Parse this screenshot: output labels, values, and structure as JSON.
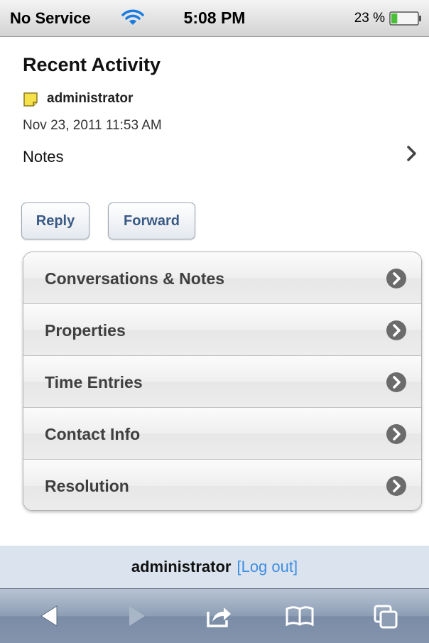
{
  "status_bar": {
    "carrier": "No Service",
    "time": "5:08 PM",
    "battery": "23 %"
  },
  "header": {
    "title": "Recent Activity"
  },
  "activity": {
    "user": "administrator",
    "date": "Nov 23, 2011 11:53 AM",
    "type": "Notes"
  },
  "actions": {
    "reply_label": "Reply",
    "forward_label": "Forward"
  },
  "menu": {
    "items": [
      {
        "label": "Conversations & Notes"
      },
      {
        "label": "Properties"
      },
      {
        "label": "Time Entries"
      },
      {
        "label": "Contact Info"
      },
      {
        "label": "Resolution"
      }
    ]
  },
  "footer": {
    "user": "administrator",
    "logout_label": "[Log out]"
  },
  "colors": {
    "accent_link": "#3d8de0",
    "button_text": "#3a5a86",
    "footer_bg": "#dbe4ee",
    "toolbar_bg": "#8c9db4"
  },
  "icons": {
    "wifi": "wifi-icon",
    "battery": "battery-icon",
    "note": "note-icon",
    "chevron": "chevron-right-icon",
    "menu_arrow": "circle-arrow-right-icon",
    "back": "back-arrow-icon",
    "forward": "forward-arrow-icon",
    "share": "share-icon",
    "bookmarks": "bookmarks-icon",
    "tabs": "tabs-icon"
  },
  "battery_level": 0.23
}
